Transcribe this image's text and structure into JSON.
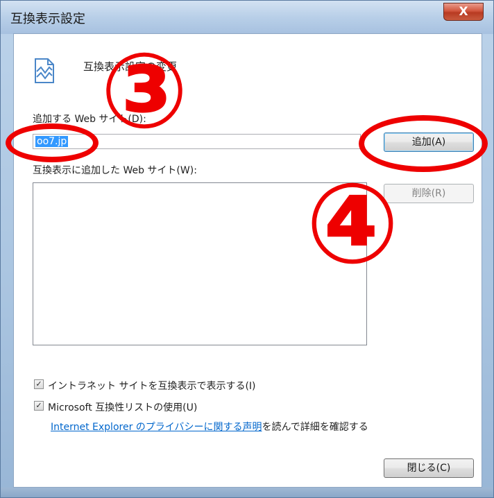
{
  "window": {
    "title": "互換表示設定",
    "close_glyph": "X"
  },
  "dialog": {
    "heading": "互換表示設定の変更",
    "add_site_label": "追加する Web サイト(D):",
    "site_input_value": "oo7.jp",
    "add_button": "追加(A)",
    "added_sites_label": "互換表示に追加した Web サイト(W):",
    "added_sites": [],
    "remove_button": "削除(R)",
    "intranet_checkbox": {
      "label": "イントラネット サイトを互換表示で表示する(I)",
      "checked": true
    },
    "ms_list_checkbox": {
      "label": "Microsoft 互換性リストの使用(U)",
      "checked": true
    },
    "privacy_link": "Internet Explorer のプライバシーに関する声明",
    "privacy_suffix": "を読んで詳細を確認する",
    "close_button": "閉じる(C)"
  },
  "annotations": {
    "step3": "③",
    "step4": "④",
    "color": "#ee0000"
  },
  "icons": {
    "page": "broken-page-icon",
    "check": "✓"
  }
}
